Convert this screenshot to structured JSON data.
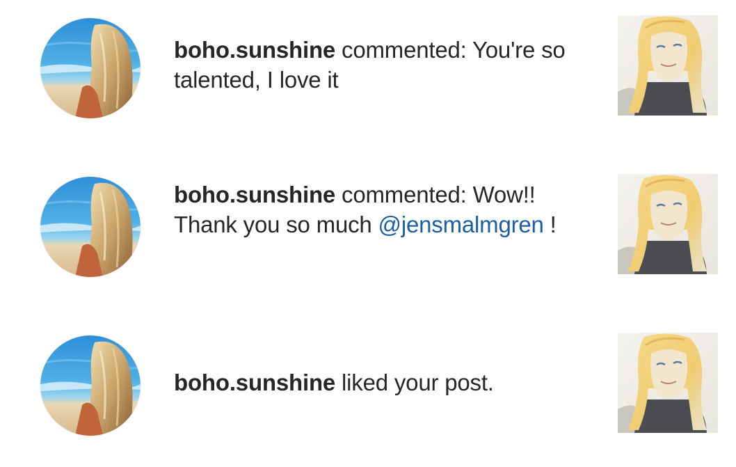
{
  "notifications": [
    {
      "username": "boho.sunshine",
      "action": " commented: You're so talented, I love it",
      "mention": "",
      "suffix": "",
      "avatar_icon": "beach-profile-photo",
      "thumbnail_icon": "portrait-painting"
    },
    {
      "username": "boho.sunshine",
      "action": " commented: Wow!! Thank you so much ",
      "mention": "@jensmalmgren",
      "suffix": " !",
      "avatar_icon": "beach-profile-photo",
      "thumbnail_icon": "portrait-painting"
    },
    {
      "username": "boho.sunshine",
      "action": " liked your post.",
      "mention": "",
      "suffix": "",
      "avatar_icon": "beach-profile-photo",
      "thumbnail_icon": "portrait-painting"
    }
  ],
  "colors": {
    "text": "#262626",
    "mention": "#1a5fa6",
    "background": "#ffffff"
  }
}
